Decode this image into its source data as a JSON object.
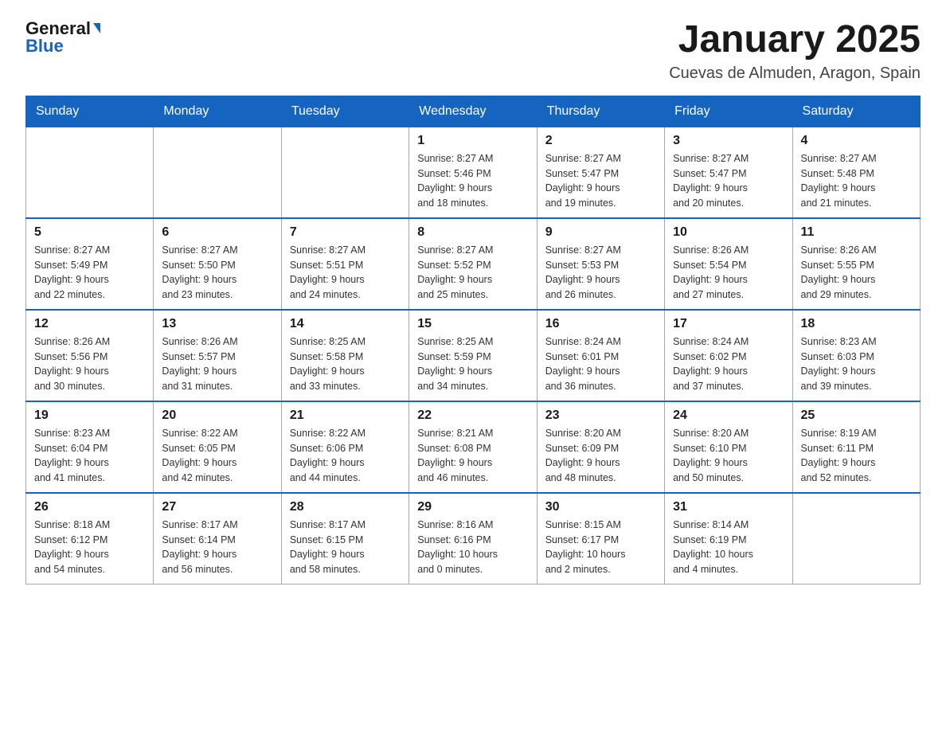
{
  "header": {
    "logo_general": "General",
    "logo_blue": "Blue",
    "title": "January 2025",
    "subtitle": "Cuevas de Almuden, Aragon, Spain"
  },
  "weekdays": [
    "Sunday",
    "Monday",
    "Tuesday",
    "Wednesday",
    "Thursday",
    "Friday",
    "Saturday"
  ],
  "weeks": [
    [
      {
        "day": "",
        "info": ""
      },
      {
        "day": "",
        "info": ""
      },
      {
        "day": "",
        "info": ""
      },
      {
        "day": "1",
        "info": "Sunrise: 8:27 AM\nSunset: 5:46 PM\nDaylight: 9 hours\nand 18 minutes."
      },
      {
        "day": "2",
        "info": "Sunrise: 8:27 AM\nSunset: 5:47 PM\nDaylight: 9 hours\nand 19 minutes."
      },
      {
        "day": "3",
        "info": "Sunrise: 8:27 AM\nSunset: 5:47 PM\nDaylight: 9 hours\nand 20 minutes."
      },
      {
        "day": "4",
        "info": "Sunrise: 8:27 AM\nSunset: 5:48 PM\nDaylight: 9 hours\nand 21 minutes."
      }
    ],
    [
      {
        "day": "5",
        "info": "Sunrise: 8:27 AM\nSunset: 5:49 PM\nDaylight: 9 hours\nand 22 minutes."
      },
      {
        "day": "6",
        "info": "Sunrise: 8:27 AM\nSunset: 5:50 PM\nDaylight: 9 hours\nand 23 minutes."
      },
      {
        "day": "7",
        "info": "Sunrise: 8:27 AM\nSunset: 5:51 PM\nDaylight: 9 hours\nand 24 minutes."
      },
      {
        "day": "8",
        "info": "Sunrise: 8:27 AM\nSunset: 5:52 PM\nDaylight: 9 hours\nand 25 minutes."
      },
      {
        "day": "9",
        "info": "Sunrise: 8:27 AM\nSunset: 5:53 PM\nDaylight: 9 hours\nand 26 minutes."
      },
      {
        "day": "10",
        "info": "Sunrise: 8:26 AM\nSunset: 5:54 PM\nDaylight: 9 hours\nand 27 minutes."
      },
      {
        "day": "11",
        "info": "Sunrise: 8:26 AM\nSunset: 5:55 PM\nDaylight: 9 hours\nand 29 minutes."
      }
    ],
    [
      {
        "day": "12",
        "info": "Sunrise: 8:26 AM\nSunset: 5:56 PM\nDaylight: 9 hours\nand 30 minutes."
      },
      {
        "day": "13",
        "info": "Sunrise: 8:26 AM\nSunset: 5:57 PM\nDaylight: 9 hours\nand 31 minutes."
      },
      {
        "day": "14",
        "info": "Sunrise: 8:25 AM\nSunset: 5:58 PM\nDaylight: 9 hours\nand 33 minutes."
      },
      {
        "day": "15",
        "info": "Sunrise: 8:25 AM\nSunset: 5:59 PM\nDaylight: 9 hours\nand 34 minutes."
      },
      {
        "day": "16",
        "info": "Sunrise: 8:24 AM\nSunset: 6:01 PM\nDaylight: 9 hours\nand 36 minutes."
      },
      {
        "day": "17",
        "info": "Sunrise: 8:24 AM\nSunset: 6:02 PM\nDaylight: 9 hours\nand 37 minutes."
      },
      {
        "day": "18",
        "info": "Sunrise: 8:23 AM\nSunset: 6:03 PM\nDaylight: 9 hours\nand 39 minutes."
      }
    ],
    [
      {
        "day": "19",
        "info": "Sunrise: 8:23 AM\nSunset: 6:04 PM\nDaylight: 9 hours\nand 41 minutes."
      },
      {
        "day": "20",
        "info": "Sunrise: 8:22 AM\nSunset: 6:05 PM\nDaylight: 9 hours\nand 42 minutes."
      },
      {
        "day": "21",
        "info": "Sunrise: 8:22 AM\nSunset: 6:06 PM\nDaylight: 9 hours\nand 44 minutes."
      },
      {
        "day": "22",
        "info": "Sunrise: 8:21 AM\nSunset: 6:08 PM\nDaylight: 9 hours\nand 46 minutes."
      },
      {
        "day": "23",
        "info": "Sunrise: 8:20 AM\nSunset: 6:09 PM\nDaylight: 9 hours\nand 48 minutes."
      },
      {
        "day": "24",
        "info": "Sunrise: 8:20 AM\nSunset: 6:10 PM\nDaylight: 9 hours\nand 50 minutes."
      },
      {
        "day": "25",
        "info": "Sunrise: 8:19 AM\nSunset: 6:11 PM\nDaylight: 9 hours\nand 52 minutes."
      }
    ],
    [
      {
        "day": "26",
        "info": "Sunrise: 8:18 AM\nSunset: 6:12 PM\nDaylight: 9 hours\nand 54 minutes."
      },
      {
        "day": "27",
        "info": "Sunrise: 8:17 AM\nSunset: 6:14 PM\nDaylight: 9 hours\nand 56 minutes."
      },
      {
        "day": "28",
        "info": "Sunrise: 8:17 AM\nSunset: 6:15 PM\nDaylight: 9 hours\nand 58 minutes."
      },
      {
        "day": "29",
        "info": "Sunrise: 8:16 AM\nSunset: 6:16 PM\nDaylight: 10 hours\nand 0 minutes."
      },
      {
        "day": "30",
        "info": "Sunrise: 8:15 AM\nSunset: 6:17 PM\nDaylight: 10 hours\nand 2 minutes."
      },
      {
        "day": "31",
        "info": "Sunrise: 8:14 AM\nSunset: 6:19 PM\nDaylight: 10 hours\nand 4 minutes."
      },
      {
        "day": "",
        "info": ""
      }
    ]
  ]
}
